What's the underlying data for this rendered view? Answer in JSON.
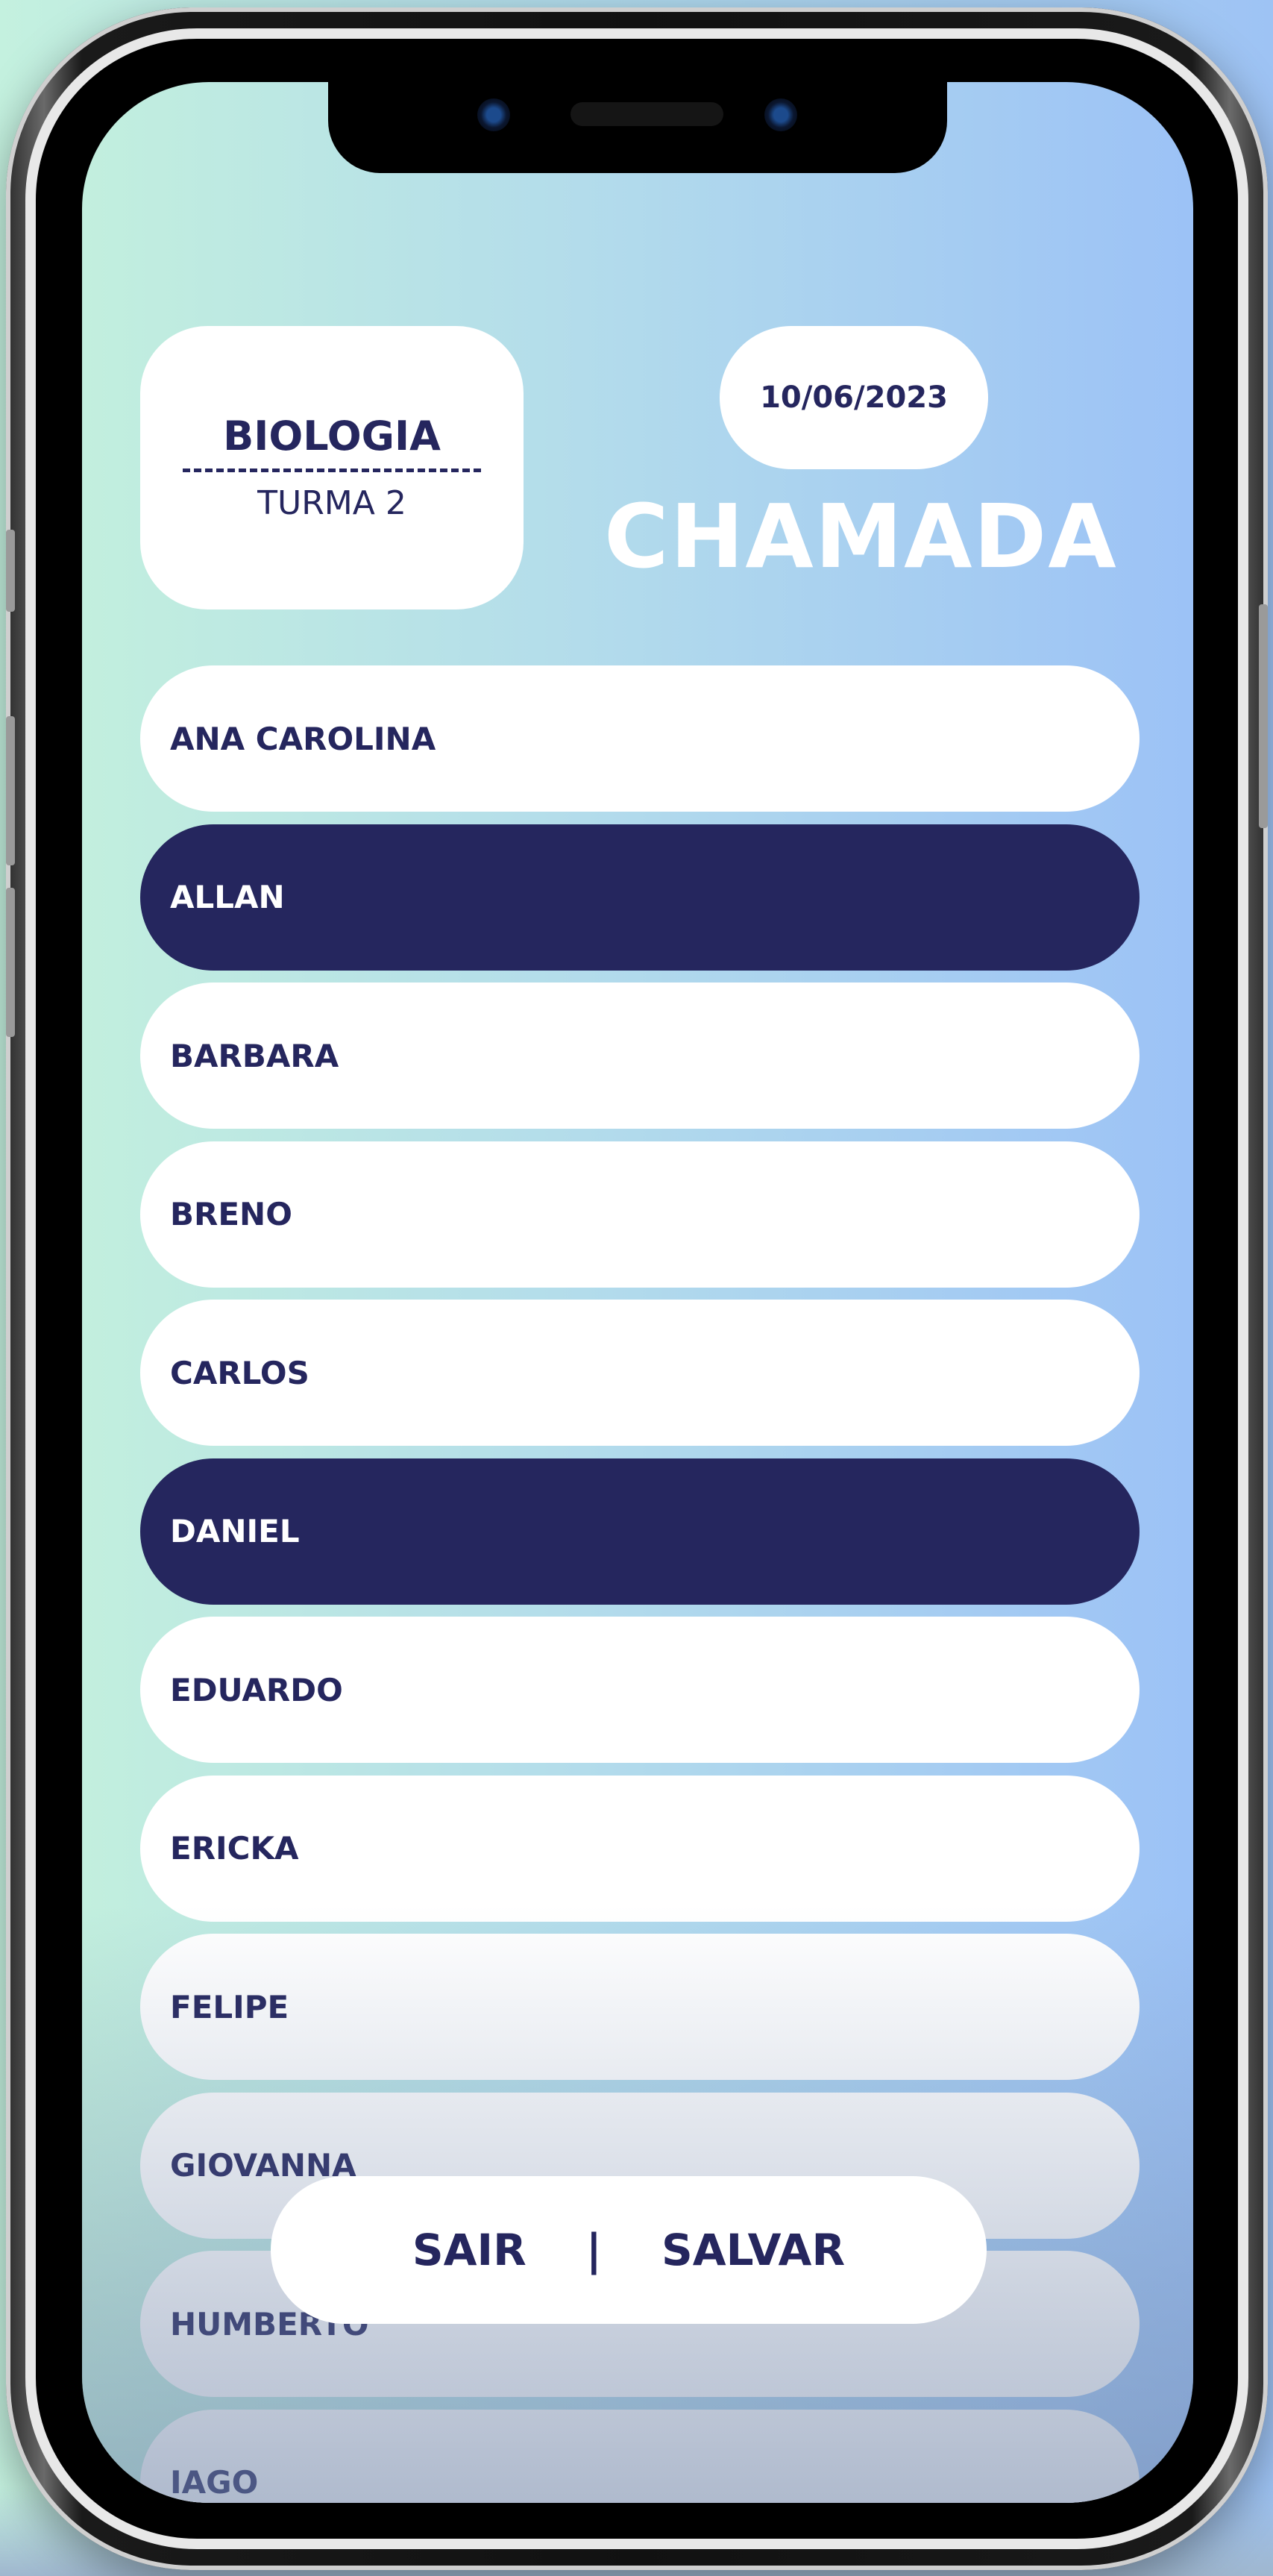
{
  "header": {
    "subject": "BIOLOGIA",
    "class_name": "TURMA 2",
    "date": "10/06/2023",
    "heading": "CHAMADA"
  },
  "students": [
    {
      "name": "ANA CAROLINA",
      "present": false
    },
    {
      "name": "ALLAN",
      "present": true
    },
    {
      "name": "BARBARA",
      "present": false
    },
    {
      "name": "BRENO",
      "present": false
    },
    {
      "name": "CARLOS",
      "present": false
    },
    {
      "name": "DANIEL",
      "present": true
    },
    {
      "name": "EDUARDO",
      "present": false
    },
    {
      "name": "ERICKA",
      "present": false
    },
    {
      "name": "FELIPE",
      "present": false
    },
    {
      "name": "GIOVANNA",
      "present": false
    },
    {
      "name": "HUMBERTO",
      "present": false
    },
    {
      "name": "IAGO",
      "present": false
    }
  ],
  "actions": {
    "exit_label": "SAIR",
    "separator": "|",
    "save_label": "SALVAR"
  },
  "colors": {
    "navy": "#25265e",
    "white": "#ffffff",
    "gradient_start": "#c2efde",
    "gradient_end": "#9cc2f6"
  }
}
